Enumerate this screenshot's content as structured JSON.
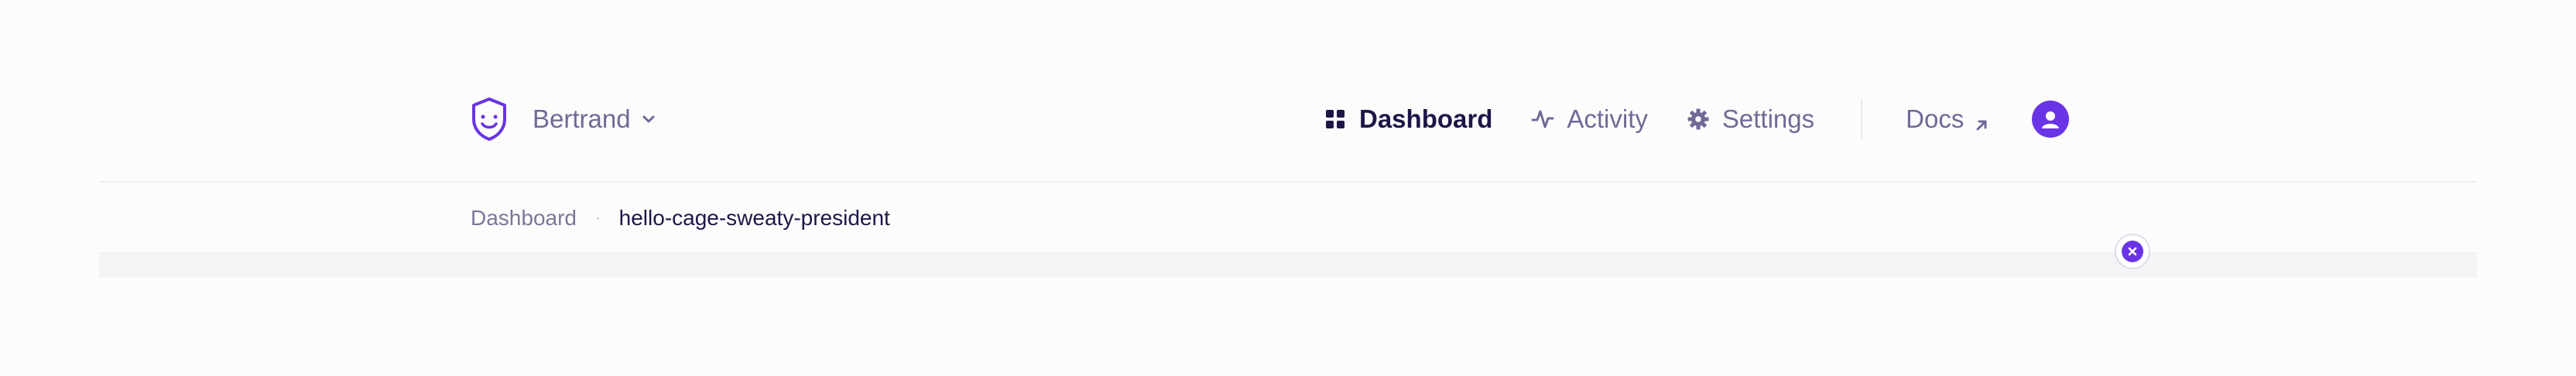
{
  "header": {
    "workspace_name": "Bertrand"
  },
  "nav": {
    "items": [
      {
        "label": "Dashboard",
        "icon": "grid-icon",
        "active": true
      },
      {
        "label": "Activity",
        "icon": "activity-icon",
        "active": false
      },
      {
        "label": "Settings",
        "icon": "gear-icon",
        "active": false
      }
    ],
    "docs_label": "Docs"
  },
  "breadcrumb": {
    "parent": "Dashboard",
    "separator": "·",
    "current": "hello-cage-sweaty-president"
  },
  "colors": {
    "accent": "#6934e6",
    "text_active": "#1f1647",
    "text_muted": "#6f6a96",
    "background": "#fcfcfd"
  }
}
